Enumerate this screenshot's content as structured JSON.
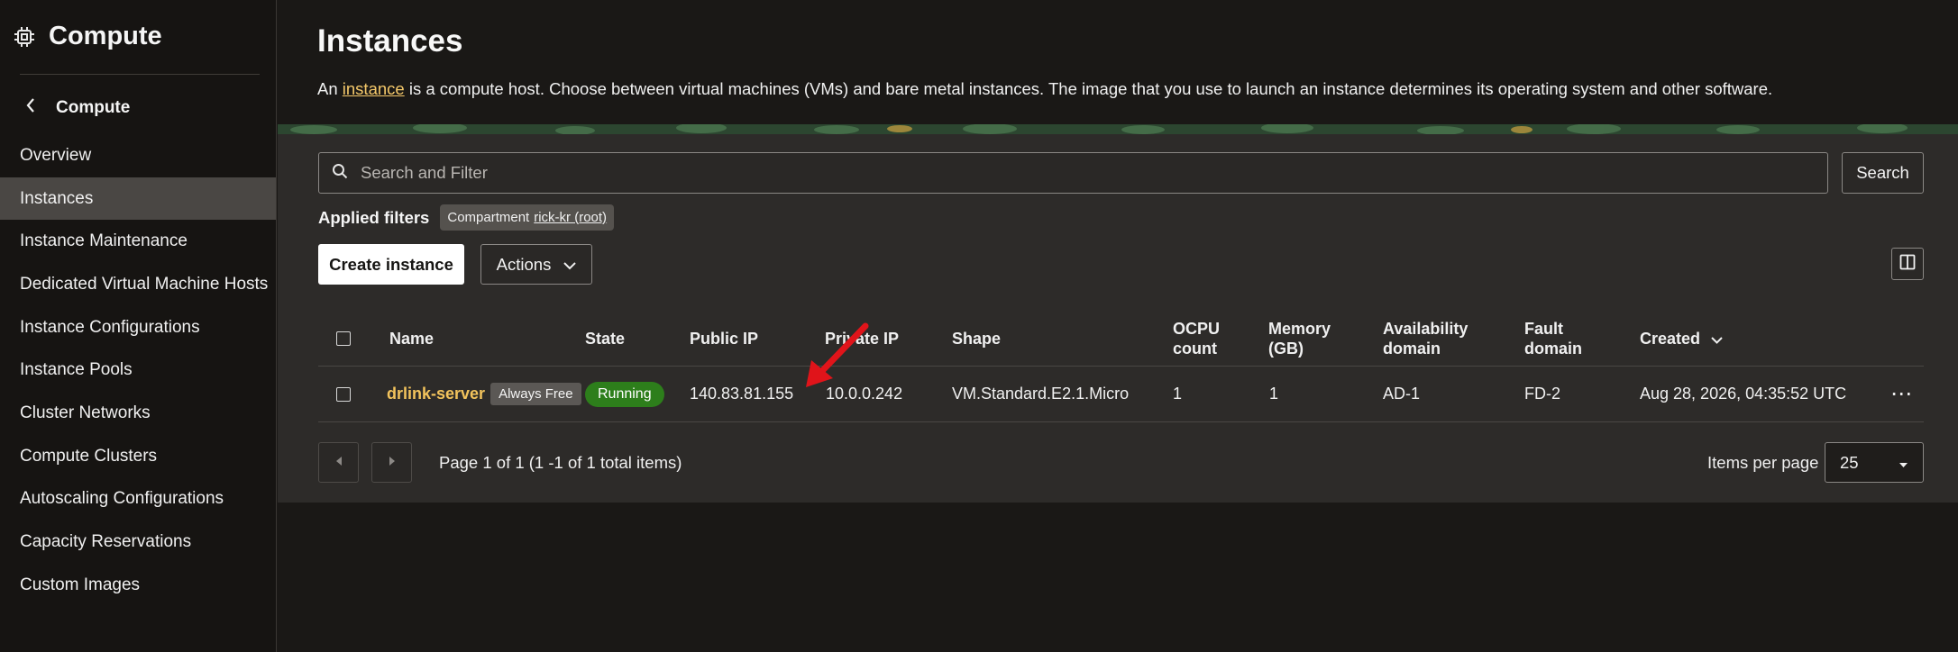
{
  "sidebar": {
    "title": "Compute",
    "back_label": "Compute",
    "items": [
      {
        "label": "Overview",
        "active": false
      },
      {
        "label": "Instances",
        "active": true
      },
      {
        "label": "Instance Maintenance",
        "active": false
      },
      {
        "label": "Dedicated Virtual Machine Hosts",
        "active": false
      },
      {
        "label": "Instance Configurations",
        "active": false
      },
      {
        "label": "Instance Pools",
        "active": false
      },
      {
        "label": "Cluster Networks",
        "active": false
      },
      {
        "label": "Compute Clusters",
        "active": false
      },
      {
        "label": "Autoscaling Configurations",
        "active": false
      },
      {
        "label": "Capacity Reservations",
        "active": false
      },
      {
        "label": "Custom Images",
        "active": false
      }
    ]
  },
  "main": {
    "title": "Instances",
    "description_prefix": "An ",
    "description_link": "instance",
    "description_suffix": " is a compute host. Choose between virtual machines (VMs) and bare metal instances. The image that you use to launch an instance determines its operating system and other software."
  },
  "search": {
    "placeholder": "Search and Filter",
    "value": "",
    "button_label": "Search"
  },
  "filters": {
    "label": "Applied filters",
    "chip_key": "Compartment",
    "chip_value": "rick-kr (root)"
  },
  "toolbar": {
    "create_label": "Create instance",
    "actions_label": "Actions"
  },
  "table": {
    "headers": {
      "name": "Name",
      "state": "State",
      "public_ip": "Public IP",
      "private_ip": "Private IP",
      "shape": "Shape",
      "ocpu_line1": "OCPU",
      "ocpu_line2": "count",
      "memory_line1": "Memory",
      "memory_line2": "(GB)",
      "ad_line1": "Availability",
      "ad_line2": "domain",
      "fd_line1": "Fault",
      "fd_line2": "domain",
      "created": "Created"
    },
    "rows": [
      {
        "name": "drlink-server",
        "badge": "Always Free",
        "state": "Running",
        "public_ip": "140.83.81.155",
        "private_ip": "10.0.0.242",
        "shape": "VM.Standard.E2.1.Micro",
        "ocpu": "1",
        "memory": "1",
        "availability_domain": "AD-1",
        "fault_domain": "FD-2",
        "created": "Aug 28, 2026, 04:35:52 UTC"
      }
    ]
  },
  "pagination": {
    "info": "Page 1 of 1 (1 -1 of 1 total items)",
    "items_per_page_label": "Items per page",
    "items_per_page": "25"
  },
  "colors": {
    "link": "#f4c86a",
    "running": "#2d7e1b",
    "annotation_arrow": "#e0141a"
  },
  "icons": [
    "chip-icon",
    "chevron-left-icon",
    "search-icon",
    "chevron-down-icon",
    "columns-icon",
    "more-icon",
    "caret-left-icon",
    "caret-right-icon",
    "caret-down-icon"
  ]
}
